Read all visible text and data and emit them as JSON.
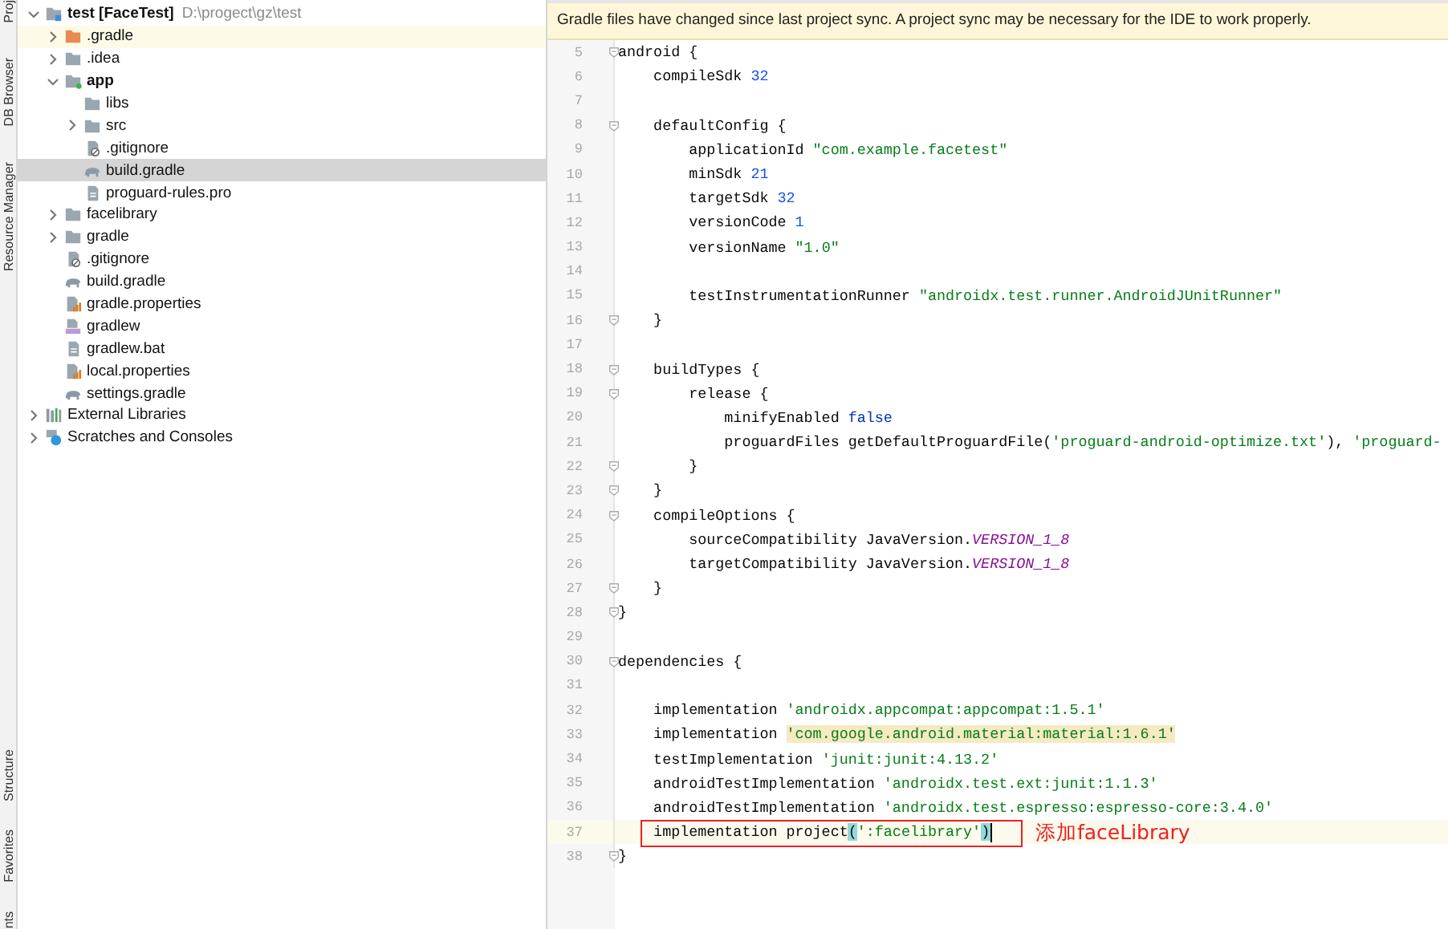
{
  "tool_strip": {
    "top": [
      {
        "label": "Proj"
      },
      {
        "label": "DB Browser"
      },
      {
        "label": "Resource Manager"
      }
    ],
    "bottom": [
      {
        "label": "Structure"
      },
      {
        "label": "Favorites"
      },
      {
        "label": "nts"
      }
    ]
  },
  "project_tree": [
    {
      "label": "test [FaceTest]",
      "path": "D:\\progect\\gz\\test",
      "kind": "project",
      "expanded": true,
      "selected": false,
      "children": [
        {
          "label": ".gradle",
          "kind": "excluded-folder",
          "expanded": false,
          "selected": false
        },
        {
          "label": ".idea",
          "kind": "folder",
          "expanded": false,
          "selected": false
        },
        {
          "label": "app",
          "kind": "module",
          "expanded": true,
          "selected": false,
          "children": [
            {
              "label": "libs",
              "kind": "folder",
              "selected": false
            },
            {
              "label": "src",
              "kind": "folder",
              "expanded": false,
              "selected": false
            },
            {
              "label": ".gitignore",
              "kind": "ignore-file",
              "selected": false
            },
            {
              "label": "build.gradle",
              "kind": "gradle-file",
              "selected": true
            },
            {
              "label": "proguard-rules.pro",
              "kind": "text-file",
              "selected": false
            }
          ]
        },
        {
          "label": "facelibrary",
          "kind": "folder",
          "expanded": false,
          "selected": false
        },
        {
          "label": "gradle",
          "kind": "folder",
          "expanded": false,
          "selected": false
        },
        {
          "label": ".gitignore",
          "kind": "ignore-file",
          "selected": false
        },
        {
          "label": "build.gradle",
          "kind": "gradle-file",
          "selected": false
        },
        {
          "label": "gradle.properties",
          "kind": "properties-file",
          "selected": false
        },
        {
          "label": "gradlew",
          "kind": "script-file",
          "selected": false
        },
        {
          "label": "gradlew.bat",
          "kind": "text-file",
          "selected": false
        },
        {
          "label": "local.properties",
          "kind": "properties-file",
          "selected": false
        },
        {
          "label": "settings.gradle",
          "kind": "gradle-file",
          "selected": false
        }
      ]
    },
    {
      "label": "External Libraries",
      "kind": "library",
      "expanded": false,
      "selected": false
    },
    {
      "label": "Scratches and Consoles",
      "kind": "scratches",
      "expanded": false,
      "selected": false
    }
  ],
  "editor": {
    "banner": "Gradle files have changed since last project sync. A project sync may be necessary for the IDE to work properly.",
    "lines": [
      {
        "number": "5",
        "fold": true,
        "current": false,
        "segments": [
          {
            "kind": "plain",
            "text": "android {"
          }
        ]
      },
      {
        "number": "6",
        "fold": false,
        "current": false,
        "segments": [
          {
            "kind": "plain",
            "text": "    compileSdk "
          },
          {
            "kind": "num",
            "text": "32"
          }
        ]
      },
      {
        "number": "7",
        "fold": false,
        "current": false
      },
      {
        "number": "8",
        "fold": true,
        "current": false,
        "segments": [
          {
            "kind": "plain",
            "text": "    defaultConfig {"
          }
        ]
      },
      {
        "number": "9",
        "fold": false,
        "current": false,
        "segments": [
          {
            "kind": "plain",
            "text": "        applicationId "
          },
          {
            "kind": "str",
            "text": "\"com.example.facetest\""
          }
        ]
      },
      {
        "number": "10",
        "fold": false,
        "current": false,
        "segments": [
          {
            "kind": "plain",
            "text": "        minSdk "
          },
          {
            "kind": "num",
            "text": "21"
          }
        ]
      },
      {
        "number": "11",
        "fold": false,
        "current": false,
        "segments": [
          {
            "kind": "plain",
            "text": "        targetSdk "
          },
          {
            "kind": "num",
            "text": "32"
          }
        ]
      },
      {
        "number": "12",
        "fold": false,
        "current": false,
        "segments": [
          {
            "kind": "plain",
            "text": "        versionCode "
          },
          {
            "kind": "num",
            "text": "1"
          }
        ]
      },
      {
        "number": "13",
        "fold": false,
        "current": false,
        "segments": [
          {
            "kind": "plain",
            "text": "        versionName "
          },
          {
            "kind": "str",
            "text": "\"1.0\""
          }
        ]
      },
      {
        "number": "14",
        "fold": false,
        "current": false
      },
      {
        "number": "15",
        "fold": false,
        "current": false,
        "segments": [
          {
            "kind": "plain",
            "text": "        testInstrumentationRunner "
          },
          {
            "kind": "str",
            "text": "\"androidx.test.runner.AndroidJUnitRunner\""
          }
        ]
      },
      {
        "number": "16",
        "fold": true,
        "current": false,
        "segments": [
          {
            "kind": "plain",
            "text": "    }"
          }
        ]
      },
      {
        "number": "17",
        "fold": false,
        "current": false
      },
      {
        "number": "18",
        "fold": true,
        "current": false,
        "segments": [
          {
            "kind": "plain",
            "text": "    buildTypes {"
          }
        ]
      },
      {
        "number": "19",
        "fold": true,
        "current": false,
        "segments": [
          {
            "kind": "plain",
            "text": "        release {"
          }
        ]
      },
      {
        "number": "20",
        "fold": false,
        "current": false,
        "segments": [
          {
            "kind": "plain",
            "text": "            minifyEnabled "
          },
          {
            "kind": "kw",
            "text": "false"
          }
        ]
      },
      {
        "number": "21",
        "fold": false,
        "current": false,
        "segments": [
          {
            "kind": "plain",
            "text": "            proguardFiles getDefaultProguardFile("
          },
          {
            "kind": "str",
            "text": "'proguard-android-optimize.txt'"
          },
          {
            "kind": "plain",
            "text": "), "
          },
          {
            "kind": "str",
            "text": "'proguard-"
          }
        ]
      },
      {
        "number": "22",
        "fold": true,
        "current": false,
        "segments": [
          {
            "kind": "plain",
            "text": "        }"
          }
        ]
      },
      {
        "number": "23",
        "fold": true,
        "current": false,
        "segments": [
          {
            "kind": "plain",
            "text": "    }"
          }
        ]
      },
      {
        "number": "24",
        "fold": true,
        "current": false,
        "segments": [
          {
            "kind": "plain",
            "text": "    compileOptions {"
          }
        ]
      },
      {
        "number": "25",
        "fold": false,
        "current": false,
        "segments": [
          {
            "kind": "plain",
            "text": "        sourceCompatibility JavaVersion."
          },
          {
            "kind": "const",
            "text": "VERSION_1_8"
          }
        ]
      },
      {
        "number": "26",
        "fold": false,
        "current": false,
        "segments": [
          {
            "kind": "plain",
            "text": "        targetCompatibility JavaVersion."
          },
          {
            "kind": "const",
            "text": "VERSION_1_8"
          }
        ]
      },
      {
        "number": "27",
        "fold": true,
        "current": false,
        "segments": [
          {
            "kind": "plain",
            "text": "    }"
          }
        ]
      },
      {
        "number": "28",
        "fold": true,
        "current": false,
        "segments": [
          {
            "kind": "plain",
            "text": "}"
          }
        ]
      },
      {
        "number": "29",
        "fold": false,
        "current": false
      },
      {
        "number": "30",
        "fold": true,
        "current": false,
        "segments": [
          {
            "kind": "plain",
            "text": "dependencies {"
          }
        ]
      },
      {
        "number": "31",
        "fold": false,
        "current": false
      },
      {
        "number": "32",
        "fold": false,
        "current": false,
        "segments": [
          {
            "kind": "plain",
            "text": "    implementation "
          },
          {
            "kind": "str",
            "text": "'androidx.appcompat:appcompat:1.5.1'"
          }
        ]
      },
      {
        "number": "33",
        "fold": false,
        "current": false,
        "segments": [
          {
            "kind": "plain",
            "text": "    implementation "
          },
          {
            "kind": "str-highlight",
            "text": "'com.google.android.material:material:1.6.1'"
          }
        ]
      },
      {
        "number": "34",
        "fold": false,
        "current": false,
        "segments": [
          {
            "kind": "plain",
            "text": "    testImplementation "
          },
          {
            "kind": "str",
            "text": "'junit:junit:4.13.2'"
          }
        ]
      },
      {
        "number": "35",
        "fold": false,
        "current": false,
        "segments": [
          {
            "kind": "plain",
            "text": "    androidTestImplementation "
          },
          {
            "kind": "str",
            "text": "'androidx.test.ext:junit:1.1.3'"
          }
        ]
      },
      {
        "number": "36",
        "fold": false,
        "current": false,
        "segments": [
          {
            "kind": "plain",
            "text": "    androidTestImplementation "
          },
          {
            "kind": "str",
            "text": "'androidx.test.espresso:espresso-core:3.4.0'"
          }
        ]
      },
      {
        "number": "37",
        "fold": false,
        "current": true,
        "annotation": "添加faceLibrary",
        "segments": [
          {
            "kind": "plain",
            "text": "    implementation project"
          },
          {
            "kind": "match",
            "text": "("
          },
          {
            "kind": "str",
            "text": "':facelibrary'"
          },
          {
            "kind": "match",
            "text": ")"
          }
        ]
      },
      {
        "number": "38",
        "fold": true,
        "current": false,
        "segments": [
          {
            "kind": "plain",
            "text": "}"
          }
        ]
      }
    ]
  }
}
